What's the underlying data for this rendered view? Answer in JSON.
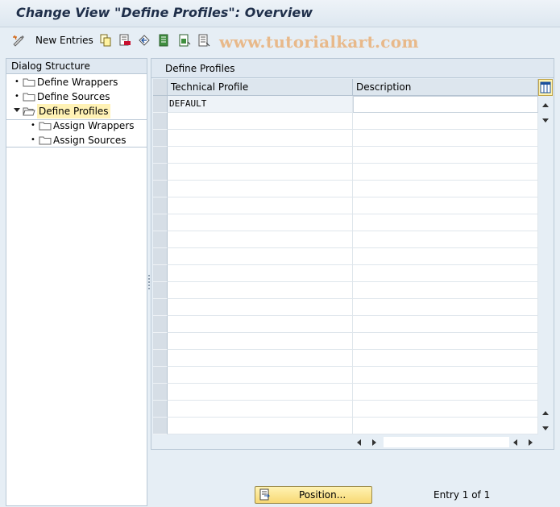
{
  "window": {
    "title": "Change View \"Define Profiles\": Overview"
  },
  "toolbar": {
    "new_entries_label": "New Entries",
    "watermark": "www.tutorialkart.com",
    "icons": [
      "edit-display-icon",
      "copy-icon",
      "delete-icon",
      "undo-icon",
      "select-all-icon",
      "select-block-icon",
      "deselect-all-icon"
    ]
  },
  "dialog_structure": {
    "header": "Dialog Structure",
    "items": [
      {
        "label": "Define Wrappers",
        "level": 0,
        "expanded": false,
        "selected": false
      },
      {
        "label": "Define Sources",
        "level": 0,
        "expanded": false,
        "selected": false
      },
      {
        "label": "Define Profiles",
        "level": 0,
        "expanded": true,
        "selected": true
      },
      {
        "label": "Assign Wrappers",
        "level": 1,
        "expanded": false,
        "selected": false
      },
      {
        "label": "Assign Sources",
        "level": 1,
        "expanded": false,
        "selected": false
      }
    ]
  },
  "table": {
    "title": "Define Profiles",
    "columns": [
      "Technical Profile",
      "Description"
    ],
    "rows": [
      [
        "DEFAULT",
        ""
      ]
    ],
    "visible_row_count": 20
  },
  "footer": {
    "position_button": "Position...",
    "entry_text": "Entry 1 of 1"
  },
  "colors": {
    "background": "#e6eef5",
    "selection": "#fff2b5",
    "button": "#f7d873"
  }
}
